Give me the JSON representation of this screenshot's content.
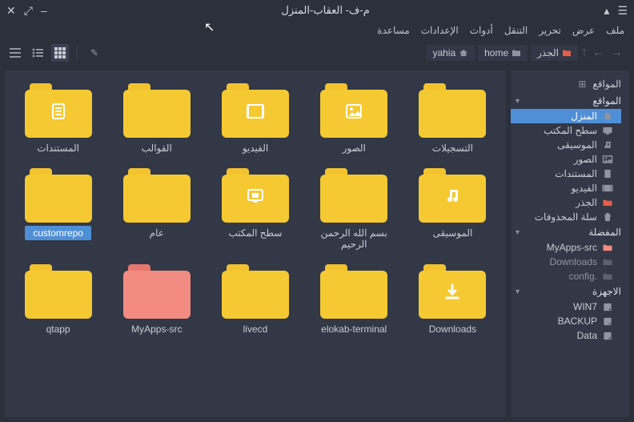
{
  "window": {
    "title": "م-ف- العقاب-المنزل"
  },
  "menu": {
    "file": "ملف",
    "view": "عرض",
    "edit": "تحرير",
    "go": "التنقل",
    "tools": "أدوات",
    "settings": "الإعدادات",
    "help": "مساعدة"
  },
  "breadcrumb": {
    "root": "الجذر",
    "home": "home",
    "user": "yahia"
  },
  "sidebar": {
    "title": "المواقع",
    "groups": [
      {
        "title": "المواقع",
        "items": [
          {
            "label": "المنزل",
            "icon": "home",
            "selected": true
          },
          {
            "label": "سطح المكتب",
            "icon": "desktop"
          },
          {
            "label": "الموسيقى",
            "icon": "music"
          },
          {
            "label": "الصور",
            "icon": "pictures"
          },
          {
            "label": "المستندات",
            "icon": "documents"
          },
          {
            "label": "الفيديو",
            "icon": "video"
          },
          {
            "label": "الجذر",
            "icon": "root"
          },
          {
            "label": "سلة المحذوفات",
            "icon": "trash"
          }
        ]
      },
      {
        "title": "المفضلة",
        "items": [
          {
            "label": "MyApps-src",
            "icon": "salmon-folder"
          },
          {
            "label": "Downloads",
            "icon": "dim-folder",
            "dim": true
          },
          {
            "label": "config.",
            "icon": "dim-folder",
            "dim": true
          }
        ]
      },
      {
        "title": "الاجهزة",
        "items": [
          {
            "label": "WIN7",
            "icon": "disk"
          },
          {
            "label": "BACKUP",
            "icon": "disk"
          },
          {
            "label": "Data",
            "icon": "disk"
          }
        ]
      }
    ]
  },
  "folders": [
    {
      "label": "المستندات",
      "overlay": "document"
    },
    {
      "label": "القوالب",
      "overlay": ""
    },
    {
      "label": "الفيديو",
      "overlay": "video"
    },
    {
      "label": "الصور",
      "overlay": "image"
    },
    {
      "label": "التسجيلات",
      "overlay": ""
    },
    {
      "label": "customrepo",
      "overlay": "",
      "selected": true
    },
    {
      "label": "عام",
      "overlay": ""
    },
    {
      "label": "سطح المكتب",
      "overlay": "desktop"
    },
    {
      "label": "بسم الله الرحمن الرحيم",
      "overlay": ""
    },
    {
      "label": "الموسيقى",
      "overlay": "music"
    },
    {
      "label": "qtapp",
      "overlay": ""
    },
    {
      "label": "MyApps-src",
      "overlay": "",
      "color": "salmon"
    },
    {
      "label": "livecd",
      "overlay": ""
    },
    {
      "label": "elokab-terminal",
      "overlay": ""
    },
    {
      "label": "Downloads",
      "overlay": "download"
    }
  ]
}
